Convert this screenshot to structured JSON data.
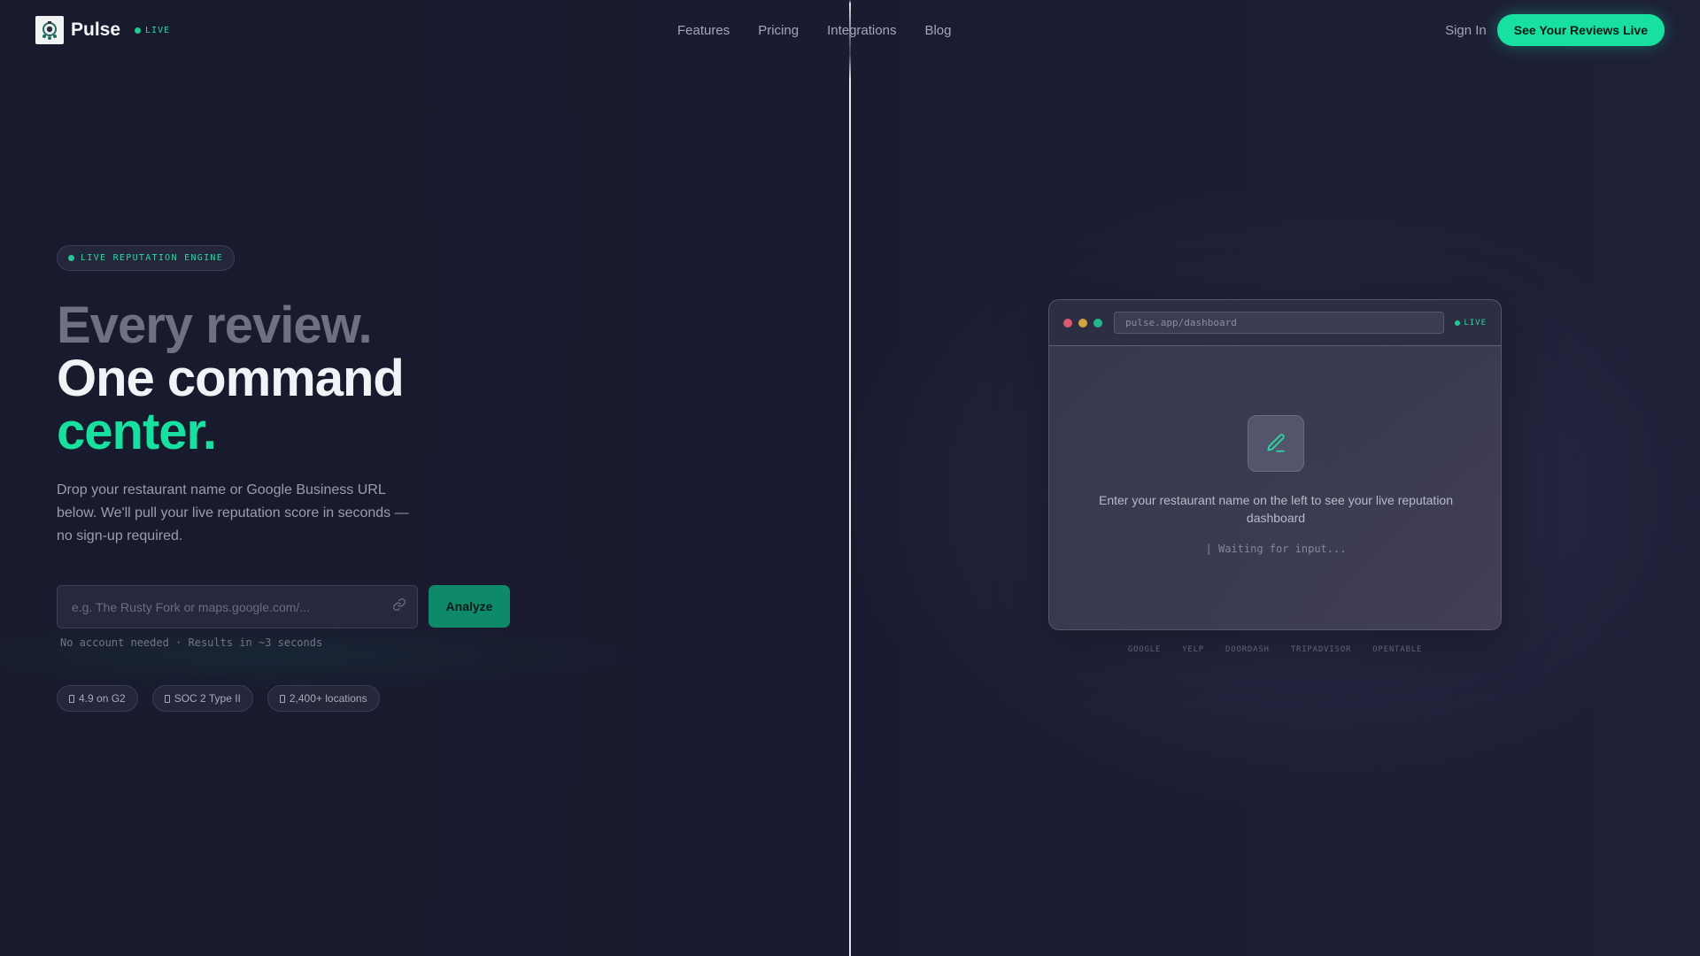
{
  "nav": {
    "brand": "Pulse",
    "live_label": "LIVE",
    "links": [
      "Features",
      "Pricing",
      "Integrations",
      "Blog"
    ],
    "sign_in": "Sign In",
    "cta": "See Your Reviews Live"
  },
  "hero": {
    "eyebrow": "LIVE REPUTATION ENGINE",
    "headline_1": "Every review.",
    "headline_2": "One command",
    "headline_3": "center.",
    "subtitle": "Drop your restaurant name or Google Business URL below. We'll pull your live reputation score in seconds — no sign-up required.",
    "search": {
      "placeholder": "e.g. The Rusty Fork or maps.google.com/...",
      "value": ""
    },
    "analyze_label": "Analyze",
    "hint": "No account needed · Results in ~3 seconds",
    "trust": [
      "4.9 on G2",
      "SOC 2 Type II",
      "2,400+ locations"
    ]
  },
  "preview": {
    "url": "pulse.app/dashboard",
    "live_label": "LIVE",
    "empty_message": "Enter your restaurant name on the left to see your live reputation dashboard",
    "waiting": "| Waiting for input...",
    "sources": [
      "GOOGLE",
      "YELP",
      "DOORDASH",
      "TRIPADVISOR",
      "OPENTABLE"
    ]
  },
  "colors": {
    "accent": "#17e0a0",
    "background": "#181a2e",
    "analyze_button": "#0e8a6b"
  },
  "icons": {
    "logo": "pulse-logo-icon",
    "search_field": "link-icon",
    "preview_tile": "pencil-edit-icon"
  }
}
